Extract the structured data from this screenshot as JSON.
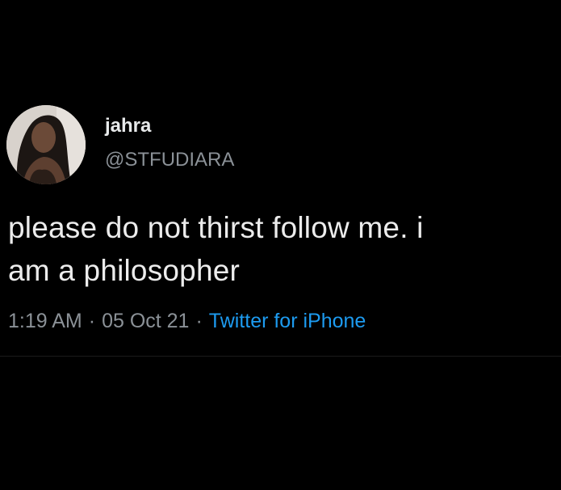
{
  "tweet": {
    "author": {
      "display_name": "jahra",
      "handle": "@STFUDIARA"
    },
    "text_line1": "please do not thirst follow me. i",
    "text_line2": "am a philosopher",
    "time": "1:19 AM",
    "date": "05 Oct 21",
    "source": "Twitter for iPhone",
    "separator": "·"
  },
  "colors": {
    "background": "#000000",
    "primary_text": "#e7e9ea",
    "secondary_text": "#8b9197",
    "link": "#1d9bf0"
  }
}
